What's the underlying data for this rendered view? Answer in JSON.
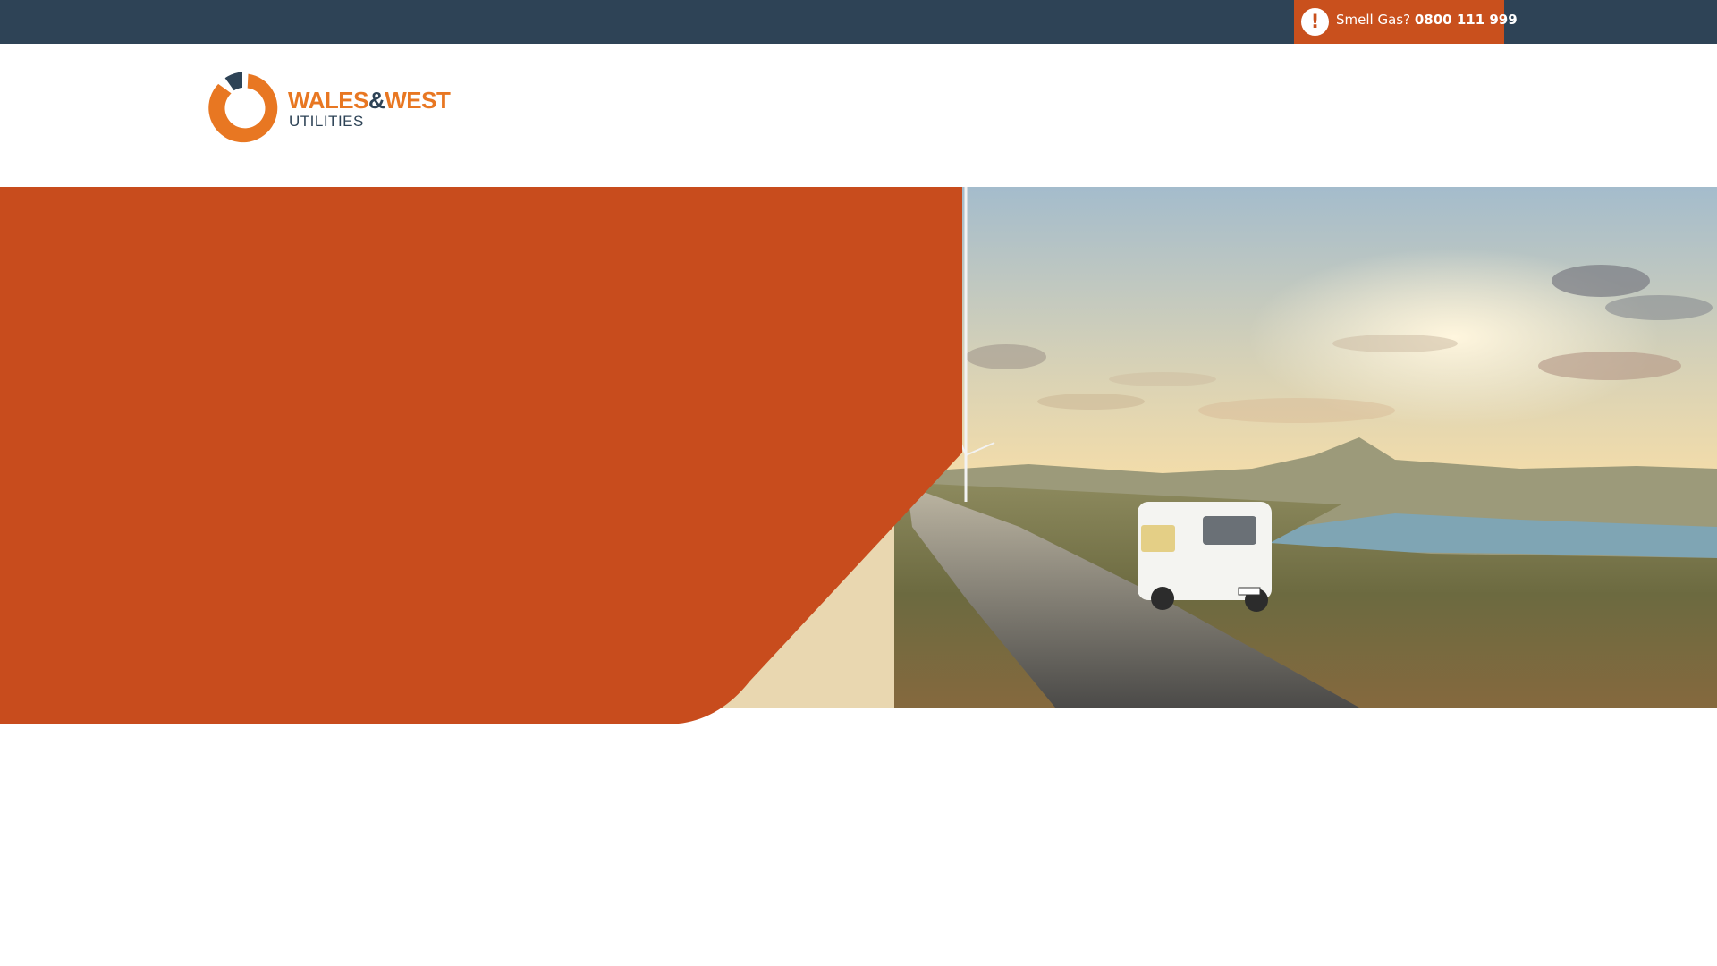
{
  "topbar": {
    "emergency": {
      "icon": "exclamation-icon",
      "label": "Smell Gas?",
      "phone": "0800 111 999"
    }
  },
  "header": {
    "logo": {
      "line1_part1": "WALES",
      "line1_amp": "&",
      "line1_part2": "WEST",
      "line2": "UTILITIES"
    }
  },
  "colors": {
    "topbar": "#2e4356",
    "accent_orange": "#c9501d",
    "logo_orange": "#e87722",
    "logo_navy": "#2e4356"
  },
  "hero": {
    "photo_icon": "landscape-van-image"
  }
}
